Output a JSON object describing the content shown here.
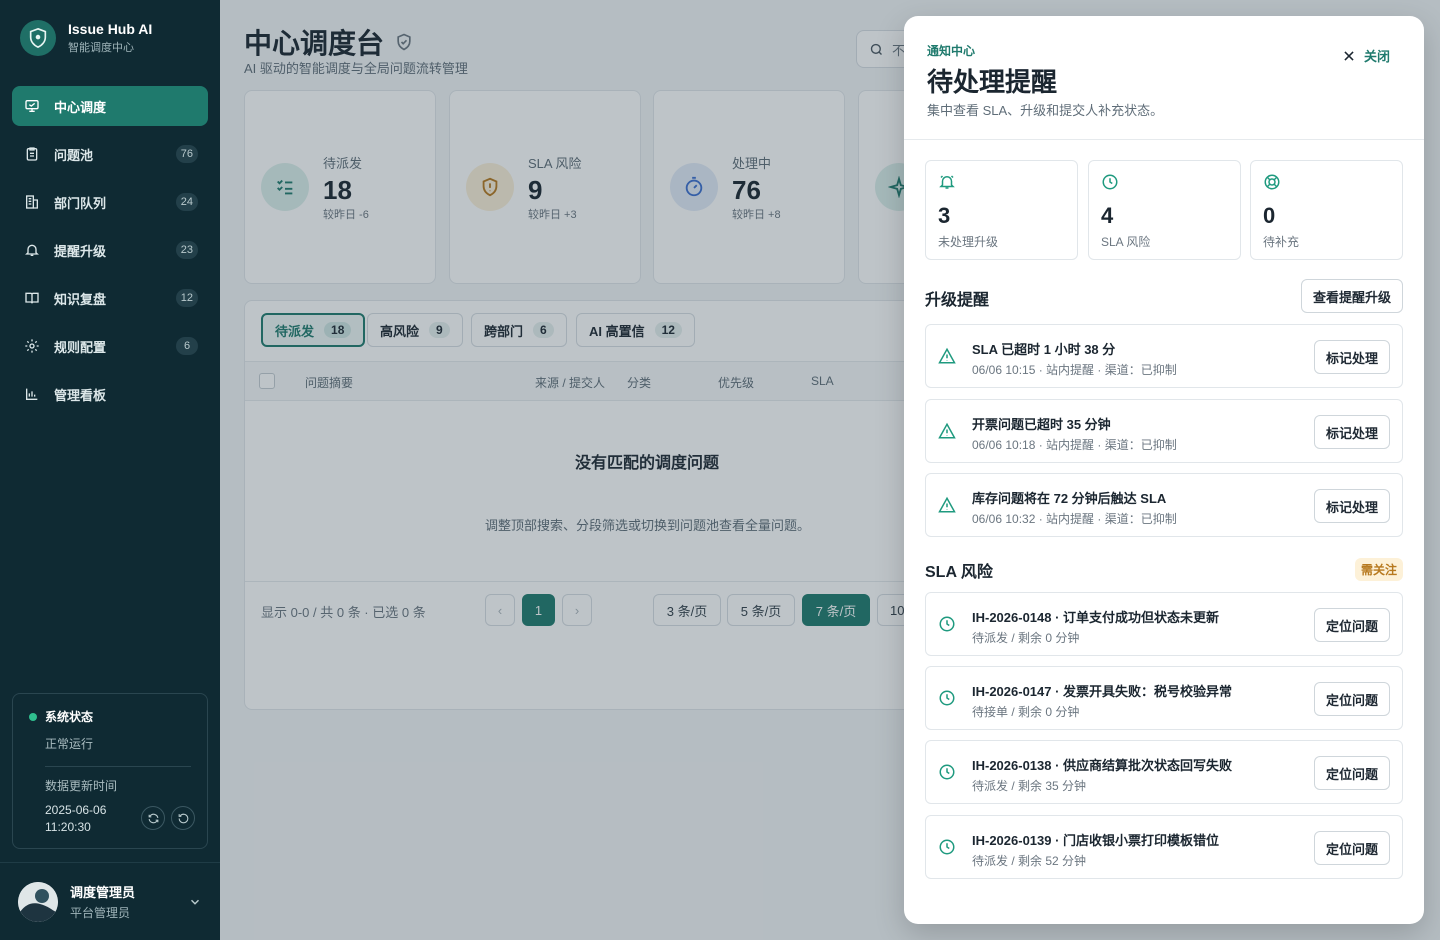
{
  "brand": {
    "name": "Issue Hub AI",
    "subtitle": "智能调度中心"
  },
  "sidebar": {
    "items": [
      {
        "label": "中心调度",
        "count": "",
        "icon": "monitor-icon",
        "active": true
      },
      {
        "label": "问题池",
        "count": "76",
        "icon": "clipboard-icon"
      },
      {
        "label": "部门队列",
        "count": "24",
        "icon": "building-icon"
      },
      {
        "label": "提醒升级",
        "count": "23",
        "icon": "bell-icon"
      },
      {
        "label": "知识复盘",
        "count": "12",
        "icon": "book-icon"
      },
      {
        "label": "规则配置",
        "count": "6",
        "icon": "gear-icon"
      },
      {
        "label": "管理看板",
        "count": "",
        "icon": "bar-chart-icon"
      }
    ]
  },
  "system_status": {
    "title": "系统状态",
    "status": "正常运行",
    "update_label": "数据更新时间",
    "update_time": "2025-06-06 11:20:30"
  },
  "user": {
    "name": "调度管理员",
    "role": "平台管理员"
  },
  "page": {
    "title": "中心调度台",
    "subtitle": "AI 驱动的智能调度与全局问题流转管理",
    "search_placeholder": "不"
  },
  "kpis": [
    {
      "label": "待派发",
      "value": "18",
      "delta": "较昨日 -6",
      "icon": "list-check-icon"
    },
    {
      "label": "SLA 风险",
      "value": "9",
      "delta": "较昨日 +3",
      "icon": "shield-alert-icon"
    },
    {
      "label": "处理中",
      "value": "76",
      "delta": "较昨日 +8",
      "icon": "stopwatch-icon"
    }
  ],
  "segments": [
    {
      "label": "待派发",
      "count": "18"
    },
    {
      "label": "高风险",
      "count": "9"
    },
    {
      "label": "跨部门",
      "count": "6"
    },
    {
      "label": "AI 高置信",
      "count": "12"
    }
  ],
  "table": {
    "columns": [
      "问题摘要",
      "来源 / 提交人",
      "分类",
      "优先级",
      "SLA"
    ],
    "empty_title": "没有匹配的调度问题",
    "empty_hint": "调整顶部搜索、分段筛选或切换到问题池查看全量问题。"
  },
  "pagination": {
    "info": "显示 0-0 / 共 0 条 · 已选 0 条",
    "prev": "‹",
    "next": "›",
    "current_page": "1",
    "page_sizes": [
      "3 条/页",
      "5 条/页",
      "7 条/页",
      "10"
    ],
    "selected_size": "7 条/页"
  },
  "drawer": {
    "eyebrow": "通知中心",
    "title": "待处理提醒",
    "subtitle": "集中查看 SLA、升级和提交人补充状态。",
    "close_label": "关闭",
    "stats": [
      {
        "value": "3",
        "label": "未处理升级",
        "icon": "bell-icon"
      },
      {
        "value": "4",
        "label": "SLA 风险",
        "icon": "clock-icon"
      },
      {
        "value": "0",
        "label": "待补充",
        "icon": "lifebuoy-icon"
      }
    ],
    "escalation": {
      "title": "升级提醒",
      "action": "查看提醒升级",
      "items": [
        {
          "title": "SLA 已超时 1 小时 38 分",
          "meta": "06/06 10:15 · 站内提醒 · 渠道：已抑制",
          "button": "标记处理"
        },
        {
          "title": "开票问题已超时 35 分钟",
          "meta": "06/06 10:18 · 站内提醒 · 渠道：已抑制",
          "button": "标记处理"
        },
        {
          "title": "库存问题将在 72 分钟后触达 SLA",
          "meta": "06/06 10:32 · 站内提醒 · 渠道：已抑制",
          "button": "标记处理"
        }
      ]
    },
    "sla": {
      "title": "SLA 风险",
      "tag": "需关注",
      "items": [
        {
          "title": "IH-2026-0148 · 订单支付成功但状态未更新",
          "meta": "待派发 / 剩余 0 分钟",
          "button": "定位问题"
        },
        {
          "title": "IH-2026-0147 · 发票开具失败：税号校验异常",
          "meta": "待接单 / 剩余 0 分钟",
          "button": "定位问题"
        },
        {
          "title": "IH-2026-0138 · 供应商结算批次状态回写失败",
          "meta": "待派发 / 剩余 35 分钟",
          "button": "定位问题"
        },
        {
          "title": "IH-2026-0139 · 门店收银小票打印模板错位",
          "meta": "待派发 / 剩余 52 分钟",
          "button": "定位问题"
        }
      ]
    }
  },
  "colors": {
    "accent": "#1f7a6d",
    "sidebar_bg": "#0f2a33",
    "warning": "#b7791f"
  }
}
